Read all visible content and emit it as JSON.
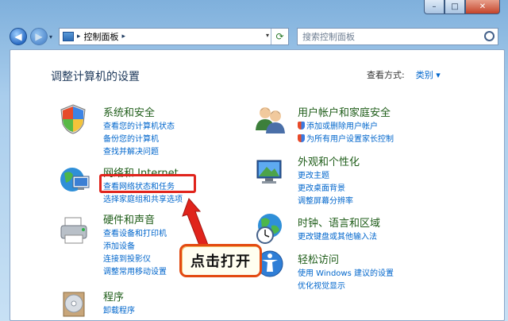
{
  "window": {
    "min": "–",
    "max": "□",
    "close": "✕"
  },
  "address": {
    "path": "控制面板",
    "sep": "▸"
  },
  "search": {
    "placeholder": "搜索控制面板"
  },
  "page": {
    "title": "调整计算机的设置",
    "view_label": "查看方式:",
    "view_value": "类别 ▾"
  },
  "categories": {
    "system": {
      "title": "系统和安全",
      "links": [
        "查看您的计算机状态",
        "备份您的计算机",
        "查找并解决问题"
      ]
    },
    "network": {
      "title": "网络和 Internet",
      "links": [
        "查看网络状态和任务",
        "选择家庭组和共享选项"
      ]
    },
    "hardware": {
      "title": "硬件和声音",
      "links": [
        "查看设备和打印机",
        "添加设备",
        "连接到投影仪",
        "调整常用移动设置"
      ]
    },
    "programs": {
      "title": "程序",
      "links": [
        "卸载程序"
      ]
    },
    "users": {
      "title": "用户帐户和家庭安全",
      "links": [
        "添加或删除用户帐户",
        "为所有用户设置家长控制"
      ]
    },
    "appearance": {
      "title": "外观和个性化",
      "links": [
        "更改主题",
        "更改桌面背景",
        "调整屏幕分辨率"
      ]
    },
    "clock": {
      "title": "时钟、语言和区域",
      "links": [
        "更改键盘或其他输入法"
      ]
    },
    "ease": {
      "title": "轻松访问",
      "links": [
        "使用 Windows 建议的设置",
        "优化视觉显示"
      ]
    }
  },
  "annotation": {
    "callout": "点击打开"
  },
  "colors": {
    "link": "#0066cc",
    "category": "#1e5c18",
    "highlight": "#e0241c"
  }
}
